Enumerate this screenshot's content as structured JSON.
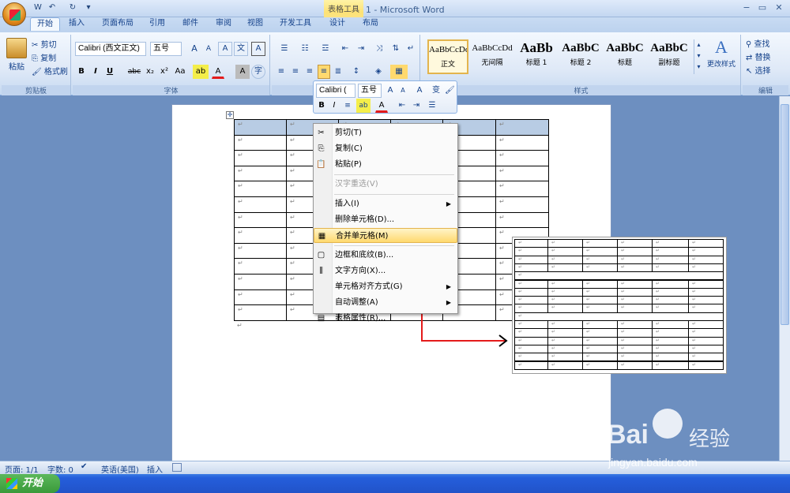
{
  "window": {
    "title": "文档 1 - Microsoft Word",
    "context_tab": "表格工具",
    "minimize": "−",
    "restore": "▭",
    "close": "✕"
  },
  "qat": [
    "W",
    "↶",
    "↻",
    "▾"
  ],
  "tabs": [
    "开始",
    "插入",
    "页面布局",
    "引用",
    "邮件",
    "审阅",
    "视图",
    "开发工具",
    "设计",
    "布局"
  ],
  "clipboard": {
    "paste": "粘贴",
    "cut": "剪切",
    "copy": "复制",
    "painter": "格式刷",
    "label": "剪贴板"
  },
  "font": {
    "name": "Calibri (西文正文)",
    "size": "五号",
    "label": "字体",
    "bold": "B",
    "italic": "I",
    "underline": "U",
    "strike": "abc",
    "sub": "x₂",
    "sup": "x²",
    "case": "Aa",
    "grow": "A",
    "shrink": "A",
    "clear": "A",
    "phonetic": "文",
    "border": "A",
    "color": "A",
    "highlight": "ab",
    "shade": "A",
    "circle": "字"
  },
  "paragraph": {
    "label": "段落"
  },
  "styles": {
    "label": "样式",
    "items": [
      {
        "preview": "AaBbCcDd",
        "name": "正文"
      },
      {
        "preview": "AaBbCcDd",
        "name": "无间隔"
      },
      {
        "preview": "AaBb",
        "name": "标题 1"
      },
      {
        "preview": "AaBbC",
        "name": "标题 2"
      },
      {
        "preview": "AaBbC",
        "name": "标题"
      },
      {
        "preview": "AaBbC",
        "name": "副标题"
      }
    ],
    "change": "更改样式"
  },
  "editing": {
    "label": "编辑",
    "find": "查找",
    "replace": "替换",
    "select": "选择"
  },
  "mini": {
    "font": "Calibri (",
    "size": "五号",
    "bold": "B",
    "italic": "I"
  },
  "menu": [
    {
      "icon": "✂",
      "label": "剪切(T)",
      "type": "normal"
    },
    {
      "icon": "⎘",
      "label": "复制(C)",
      "type": "normal"
    },
    {
      "icon": "📋",
      "label": "粘贴(P)",
      "type": "normal"
    },
    {
      "sep": true
    },
    {
      "icon": "",
      "label": "汉字重选(V)",
      "type": "disabled"
    },
    {
      "sep": true
    },
    {
      "icon": "",
      "label": "插入(I)",
      "type": "sub"
    },
    {
      "icon": "",
      "label": "删除单元格(D)...",
      "type": "normal"
    },
    {
      "icon": "▦",
      "label": "合并单元格(M)",
      "type": "highlight"
    },
    {
      "sep": true
    },
    {
      "icon": "▢",
      "label": "边框和底纹(B)...",
      "type": "normal"
    },
    {
      "icon": "⫼",
      "label": "文字方向(X)...",
      "type": "normal"
    },
    {
      "icon": "",
      "label": "单元格对齐方式(G)",
      "type": "sub"
    },
    {
      "icon": "",
      "label": "自动调整(A)",
      "type": "sub"
    },
    {
      "icon": "▤",
      "label": "表格属性(R)...",
      "type": "normal"
    }
  ],
  "status": {
    "page": "页面: 1/1",
    "words": "字数: 0",
    "lang": "英语(美国)",
    "mode": "插入"
  },
  "taskbar": {
    "start": "开始"
  },
  "watermark": {
    "brand": "Bai",
    "brand2": "经验",
    "url": "jingyan.baidu.com"
  },
  "colors": {
    "accent": "#15428b",
    "highlight": "#ffd96e",
    "arrow": "#e41b1b"
  }
}
